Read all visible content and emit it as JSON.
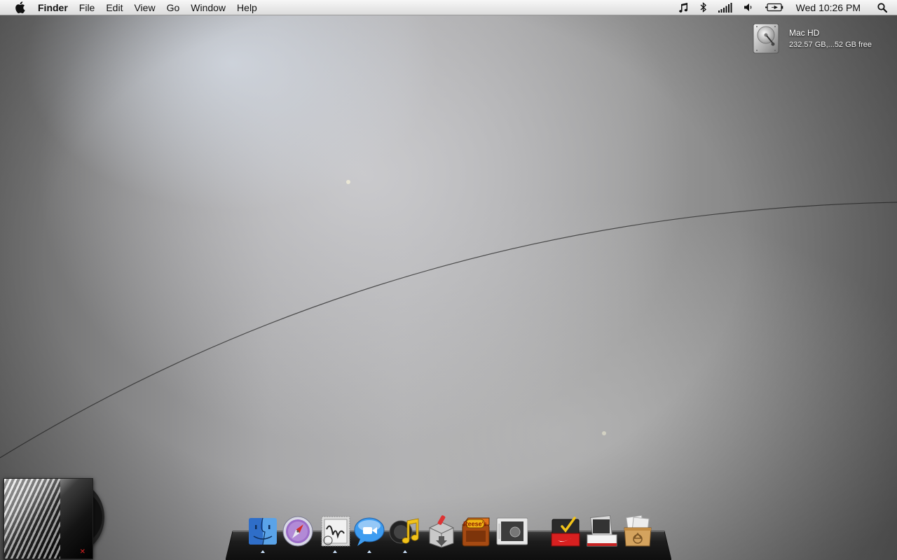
{
  "menubar": {
    "apple_icon": "apple-logo-icon",
    "app_name": "Finder",
    "menus": [
      "File",
      "Edit",
      "View",
      "Go",
      "Window",
      "Help"
    ],
    "status_icons": [
      "itunes-note-icon",
      "bluetooth-icon",
      "wifi-signal-icon",
      "volume-icon",
      "battery-icon"
    ],
    "clock": "Wed 10:26 PM",
    "spotlight_icon": "spotlight-search-icon"
  },
  "desktop": {
    "drive": {
      "name": "Mac HD",
      "info": "232.57 GB,...52 GB free",
      "icon": "hard-drive-icon"
    }
  },
  "widget": {
    "icon": "album-art-widget",
    "cover_mark": "✕"
  },
  "dock": {
    "apps": [
      {
        "name": "Finder",
        "icon": "finder-icon",
        "running": true
      },
      {
        "name": "Safari",
        "icon": "safari-compass-icon",
        "running": false
      },
      {
        "name": "Mail",
        "icon": "mail-stamp-icon",
        "running": true
      },
      {
        "name": "iChat",
        "icon": "ichat-bubble-icon",
        "running": true
      },
      {
        "name": "iTunes",
        "icon": "itunes-icon",
        "running": true
      },
      {
        "name": "Installer",
        "icon": "installer-icon",
        "running": false
      },
      {
        "name": "Reese's",
        "icon": "reeses-icon",
        "running": false
      },
      {
        "name": "Preview",
        "icon": "preview-photo-icon",
        "running": false
      },
      {
        "name": "Things",
        "icon": "nike-box-check-icon",
        "running": false
      },
      {
        "name": "Downloads",
        "icon": "downloads-stack-icon",
        "running": false
      },
      {
        "name": "Trash",
        "icon": "recycle-box-icon",
        "running": false
      }
    ]
  },
  "colors": {
    "menubar_top": "#f7f7f7",
    "menubar_bottom": "#dcdcdc",
    "dock_shelf": "#1b1b1b",
    "running_light": "#cfe6ff"
  }
}
